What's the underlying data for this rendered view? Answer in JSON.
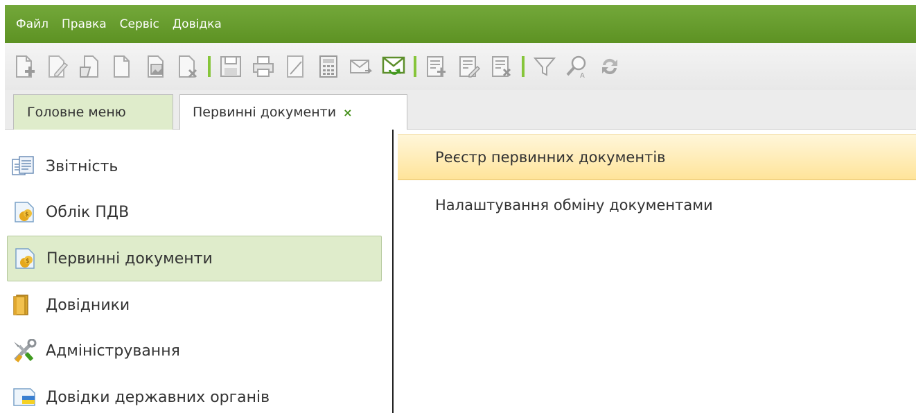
{
  "menu": {
    "items": [
      "Файл",
      "Правка",
      "Сервіс",
      "Довідка"
    ]
  },
  "toolbar": {
    "icons": [
      "add-document-icon",
      "edit-document-icon",
      "open-document-icon",
      "copy-document-icon",
      "document-images-icon",
      "delete-document-icon",
      "save-icon",
      "print-icon",
      "sign-icon",
      "calculator-icon",
      "mail-send-icon",
      "mail-receive-icon",
      "add-list-icon",
      "edit-list-icon",
      "delete-list-icon",
      "filter-icon",
      "find-icon",
      "refresh-icon"
    ]
  },
  "tabs": [
    {
      "label": "Головне меню"
    },
    {
      "label": "Первинні документи",
      "close": "×"
    }
  ],
  "nav": {
    "items": [
      {
        "label": "Звітність",
        "icon": "reports-icon"
      },
      {
        "label": "Облік ПДВ",
        "icon": "vat-accounting-icon"
      },
      {
        "label": "Первинні документи",
        "icon": "primary-documents-icon",
        "selected": true
      },
      {
        "label": "Довідники",
        "icon": "directories-icon"
      },
      {
        "label": "Адміністрування",
        "icon": "administration-icon"
      },
      {
        "label": "Довідки державних органів",
        "icon": "gov-references-icon"
      }
    ]
  },
  "panel": {
    "items": [
      {
        "label": "Реєстр первинних документів",
        "highlighted": true
      },
      {
        "label": "Налаштування обміну документами"
      }
    ]
  },
  "colors": {
    "menubar": "#6aa031",
    "separator": "#86c53a",
    "selected_bg": "#dfeccb",
    "highlight_bg": "#ffe49a"
  }
}
